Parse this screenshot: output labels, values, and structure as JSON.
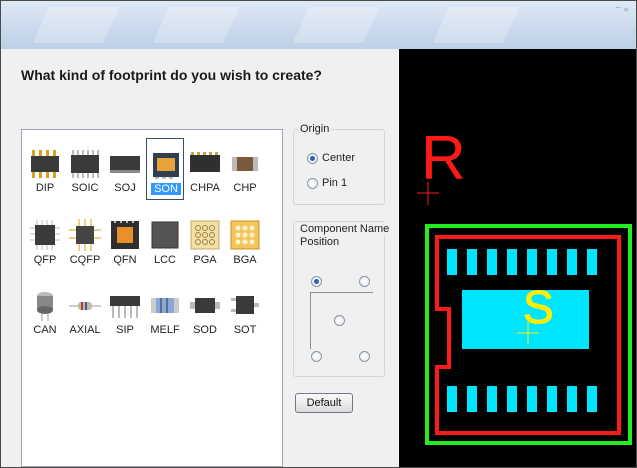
{
  "dialog": {
    "question": "What kind of footprint do you wish to create?",
    "default_button": "Default"
  },
  "footprints": [
    {
      "label": "DIP",
      "icon": "dip-icon",
      "selected": false
    },
    {
      "label": "SOIC",
      "icon": "soic-icon",
      "selected": false
    },
    {
      "label": "SOJ",
      "icon": "soj-icon",
      "selected": false
    },
    {
      "label": "SON",
      "icon": "son-icon",
      "selected": true
    },
    {
      "label": "CHPA",
      "icon": "chpa-icon",
      "selected": false
    },
    {
      "label": "CHP",
      "icon": "chp-icon",
      "selected": false
    },
    {
      "label": "QFP",
      "icon": "qfp-icon",
      "selected": false
    },
    {
      "label": "CQFP",
      "icon": "cqfp-icon",
      "selected": false
    },
    {
      "label": "QFN",
      "icon": "qfn-icon",
      "selected": false
    },
    {
      "label": "LCC",
      "icon": "lcc-icon",
      "selected": false
    },
    {
      "label": "PGA",
      "icon": "pga-icon",
      "selected": false
    },
    {
      "label": "BGA",
      "icon": "bga-icon",
      "selected": false
    },
    {
      "label": "CAN",
      "icon": "can-icon",
      "selected": false
    },
    {
      "label": "AXIAL",
      "icon": "axial-icon",
      "selected": false
    },
    {
      "label": "SIP",
      "icon": "sip-icon",
      "selected": false
    },
    {
      "label": "MELF",
      "icon": "melf-icon",
      "selected": false
    },
    {
      "label": "SOD",
      "icon": "sod-icon",
      "selected": false
    },
    {
      "label": "SOT",
      "icon": "sot-icon",
      "selected": false
    }
  ],
  "origin": {
    "title": "Origin",
    "options": [
      "Center",
      "Pin 1"
    ],
    "selected": "Center"
  },
  "name_position": {
    "title_line1": "Component Name",
    "title_line2": "Position",
    "selected": "top-left"
  },
  "preview": {
    "ref_label": "R",
    "value_label": "S",
    "colors": {
      "background": "#000000",
      "reference": "#ff1a1a",
      "outline": "#22ee22",
      "courtyard": "#ff1a1a",
      "pads": "#00e5ff",
      "body": "#00e5ff",
      "value": "#ffee00"
    }
  }
}
